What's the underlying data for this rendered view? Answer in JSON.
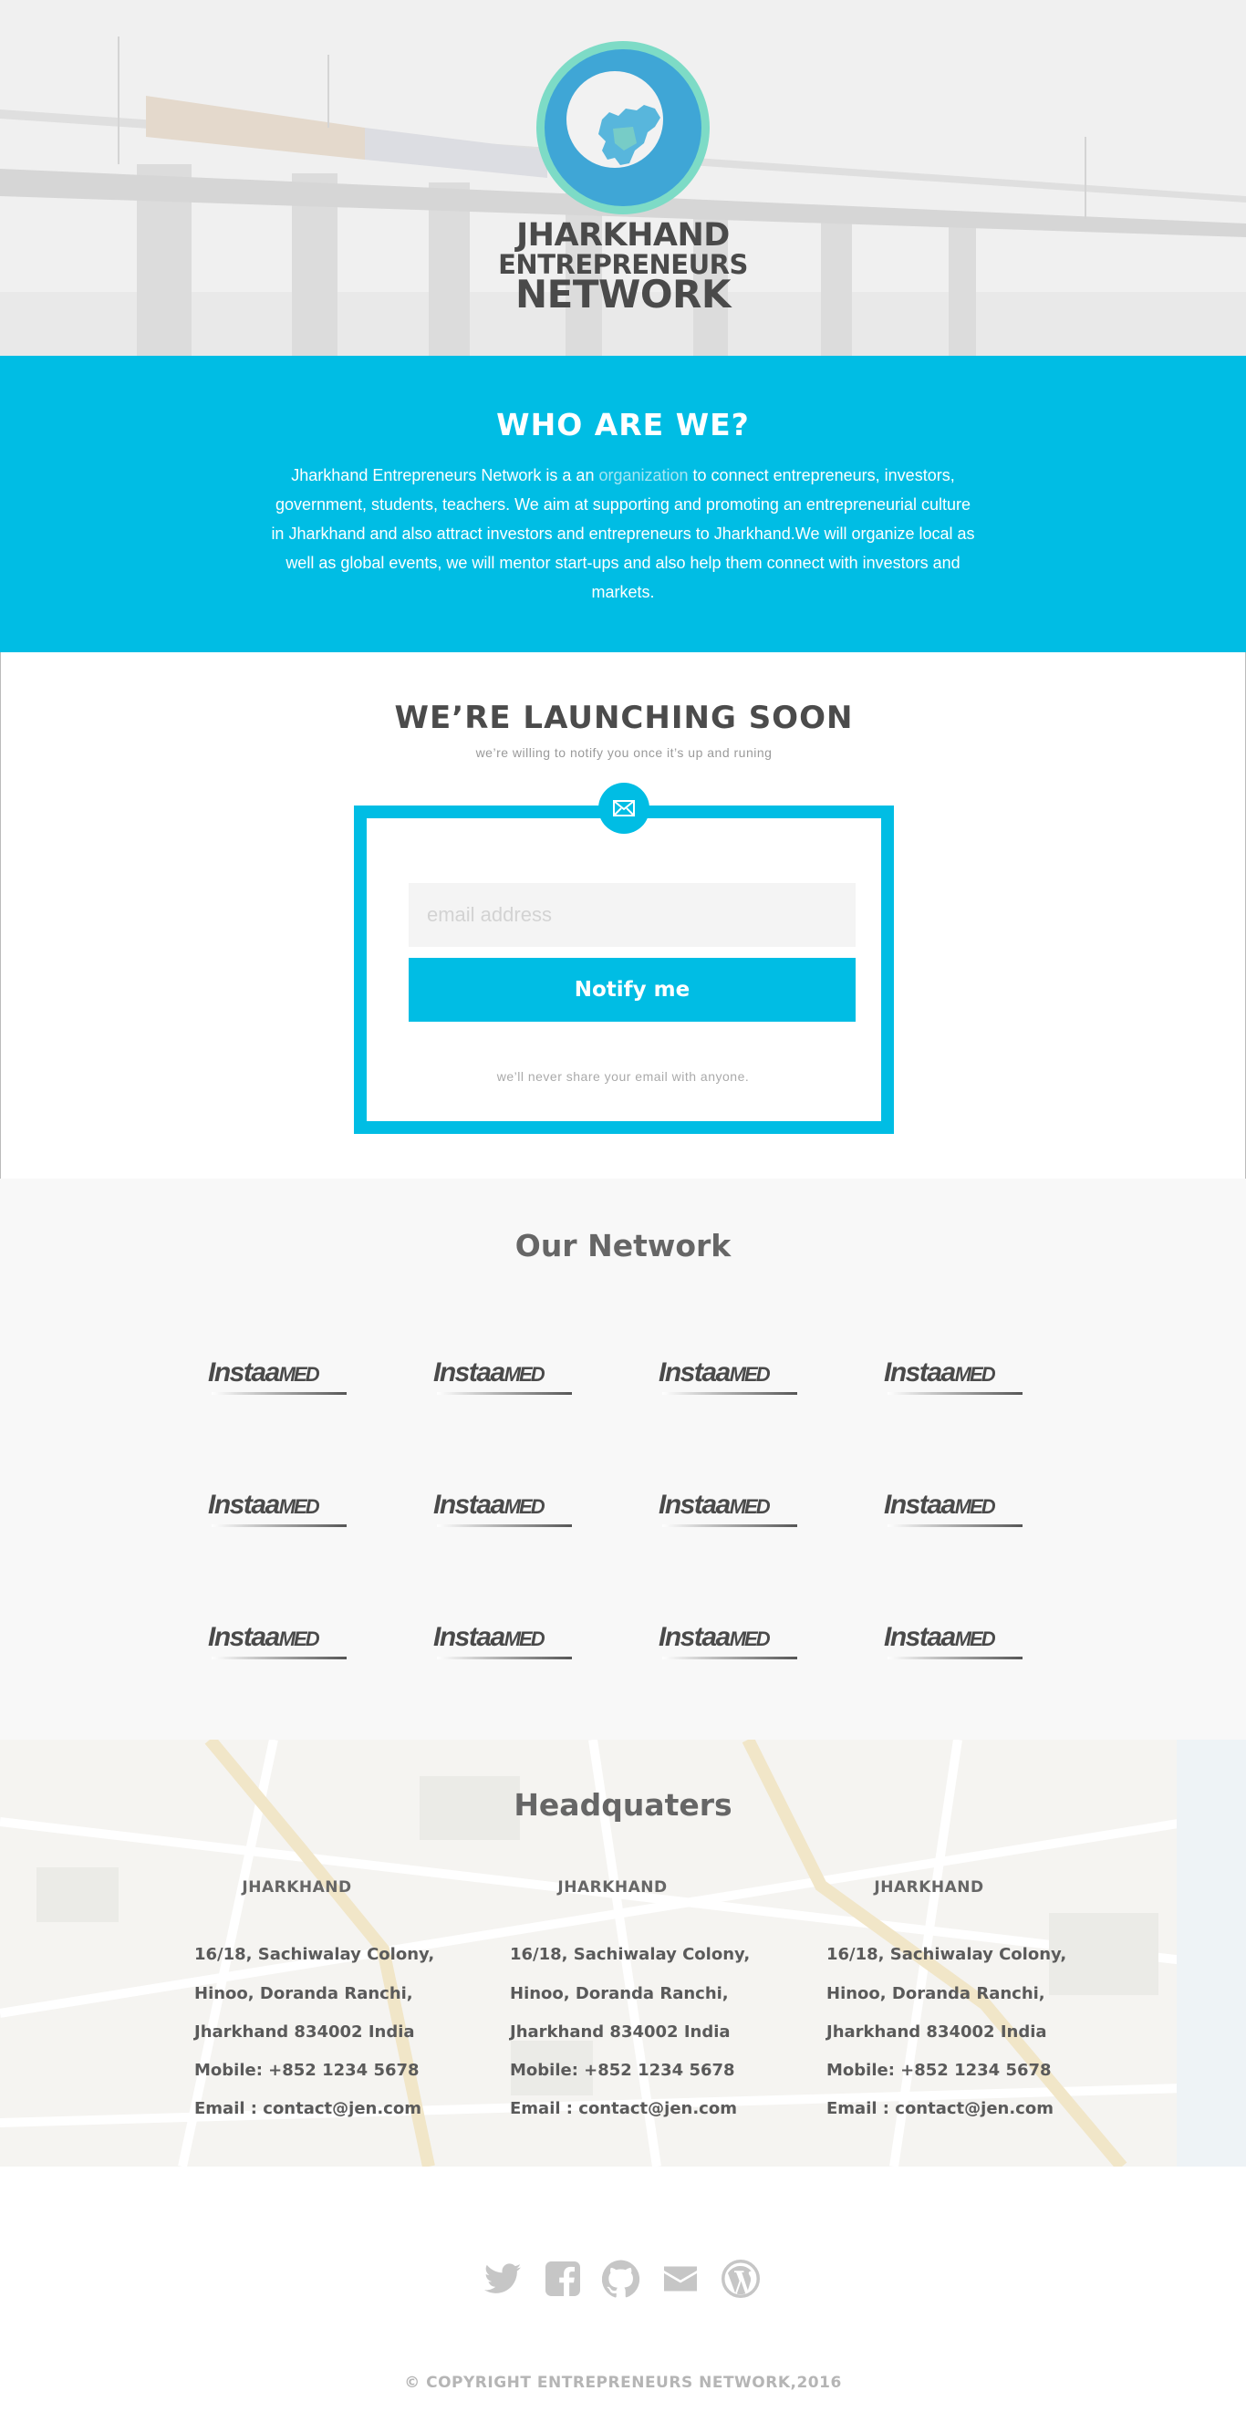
{
  "hero": {
    "logo_line1": "JHARKHAND",
    "logo_line2": "ENTREPRENEURS",
    "logo_line3": "NETWORK"
  },
  "about": {
    "title": "WHO ARE WE?",
    "text_before": "Jharkhand Entrepreneurs Network is a an ",
    "link_text": "organization",
    "text_after": " to connect entrepreneurs, investors, government, students, teachers. We aim at supporting and promoting an entrepreneurial culture in Jharkhand and also attract investors and entrepreneurs to Jharkhand.We will organize local as well as global events, we will mentor start-ups and also help them connect with investors and markets."
  },
  "launch": {
    "title": "WE’RE LAUNCHING SOON",
    "subtitle": "we’re willing to notify you once it’s up and runing",
    "email_placeholder": "email address",
    "button_label": "Notify me",
    "privacy_note": "we’ll never share your email with anyone.",
    "mail_icon": "envelope-icon"
  },
  "network": {
    "title": "Our Network",
    "partners": [
      {
        "brand": "Instaa",
        "suffix": "MED"
      },
      {
        "brand": "Instaa",
        "suffix": "MED"
      },
      {
        "brand": "Instaa",
        "suffix": "MED"
      },
      {
        "brand": "Instaa",
        "suffix": "MED"
      },
      {
        "brand": "Instaa",
        "suffix": "MED"
      },
      {
        "brand": "Instaa",
        "suffix": "MED"
      },
      {
        "brand": "Instaa",
        "suffix": "MED"
      },
      {
        "brand": "Instaa",
        "suffix": "MED"
      },
      {
        "brand": "Instaa",
        "suffix": "MED"
      },
      {
        "brand": "Instaa",
        "suffix": "MED"
      },
      {
        "brand": "Instaa",
        "suffix": "MED"
      },
      {
        "brand": "Instaa",
        "suffix": "MED"
      }
    ]
  },
  "headquarters": {
    "title": "Headquaters",
    "offices": [
      {
        "city": "JHARKHAND",
        "line1": "16/18, Sachiwalay Colony,",
        "line2": "Hinoo, Doranda Ranchi,",
        "line3": "Jharkhand 834002 India",
        "mobile": "Mobile: +852 1234 5678",
        "email": "Email : contact@jen.com"
      },
      {
        "city": "JHARKHAND",
        "line1": "16/18, Sachiwalay Colony,",
        "line2": "Hinoo, Doranda Ranchi,",
        "line3": "Jharkhand 834002 India",
        "mobile": "Mobile: +852 1234 5678",
        "email": "Email : contact@jen.com"
      },
      {
        "city": "JHARKHAND",
        "line1": "16/18, Sachiwalay Colony,",
        "line2": "Hinoo, Doranda Ranchi,",
        "line3": "Jharkhand 834002 India",
        "mobile": "Mobile: +852 1234 5678",
        "email": "Email : contact@jen.com"
      }
    ]
  },
  "footer": {
    "social": [
      "twitter-icon",
      "facebook-icon",
      "github-icon",
      "mail-icon",
      "wordpress-icon"
    ],
    "copyright": "© COPYRIGHT ENTREPRENEURS NETWORK,2016"
  },
  "colors": {
    "accent": "#00bde4",
    "emblem_outer": "#7ddbc6",
    "emblem_inner": "#3fa6d6",
    "heading": "#4b4b4b",
    "footer_icons": "#c6c6c6"
  }
}
